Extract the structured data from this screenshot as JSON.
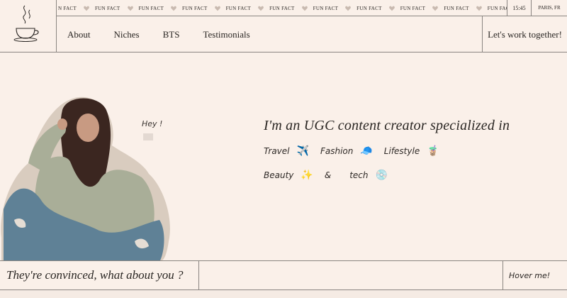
{
  "ticker": {
    "items": [
      "N FACT",
      "FUN FACT",
      "FUN FACT",
      "FUN FACT",
      "FUN FACT",
      "FUN FACT",
      "FUN FACT",
      "FUN FACT",
      "FUN FACT",
      "FUN FACT",
      "FUN FACT"
    ],
    "time": "15:45",
    "location": "PARIS, FR"
  },
  "nav": {
    "about": "About",
    "niches": "Niches",
    "bts": "BTS",
    "testimonials": "Testimonials",
    "cta": "Let's work together!"
  },
  "hero": {
    "greeting": "Hey !",
    "headline": "I'm an UGC content creator specialized in",
    "niches_row1": [
      {
        "word": "Travel",
        "emoji": "✈️"
      },
      {
        "word": "Fashion",
        "emoji": "🧢"
      },
      {
        "word": "Lifestyle",
        "emoji": "🧋"
      }
    ],
    "niches_row2": [
      {
        "word": "Beauty",
        "emoji": "✨"
      },
      {
        "word": "&",
        "emoji": ""
      },
      {
        "word": "tech",
        "emoji": "💿"
      }
    ]
  },
  "bottom": {
    "convinced": "They're convinced, what about you ?",
    "input_value": "",
    "hover": "Hover me!"
  },
  "colors": {
    "background": "#faf0e9",
    "text": "#2a2623",
    "border": "#8a8581",
    "heart": "#c9bab0"
  },
  "icons": {
    "logo": "coffee-cup-icon",
    "separator": "heart-icon"
  }
}
